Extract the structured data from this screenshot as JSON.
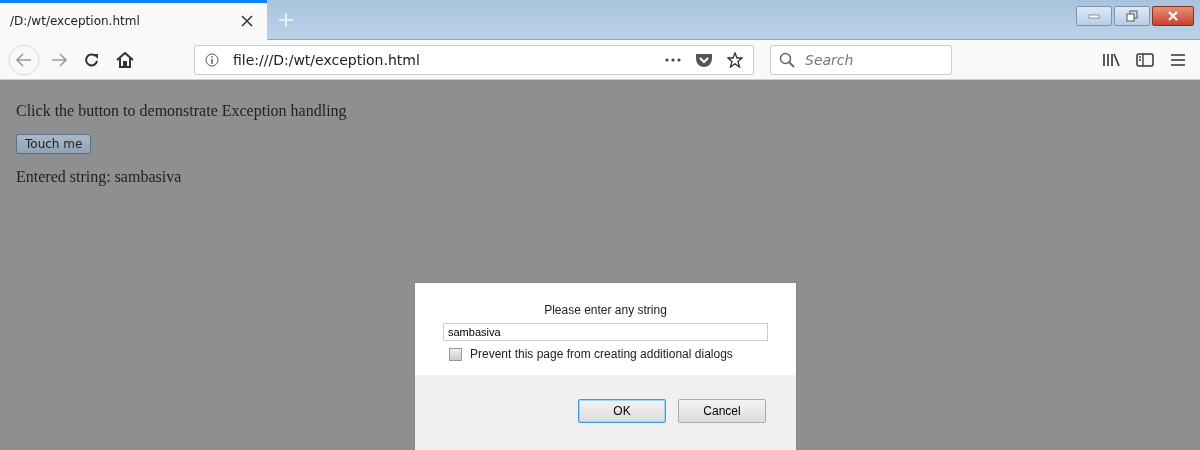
{
  "tab": {
    "title": "/D:/wt/exception.html",
    "selected": true
  },
  "address": {
    "url": "file:///D:/wt/exception.html"
  },
  "search": {
    "placeholder": "Search"
  },
  "page": {
    "heading": "Click the button to demonstrate Exception handling",
    "button": "Touch me",
    "result": "Entered string: sambasiva"
  },
  "dialog": {
    "message": "Please enter any string",
    "value": "sambasiva",
    "checkbox": {
      "label": "Prevent this page from creating additional dialogs",
      "checked": false
    },
    "buttons": [
      {
        "label": "OK",
        "selected": true
      },
      {
        "label": "Cancel",
        "selected": false
      }
    ]
  }
}
